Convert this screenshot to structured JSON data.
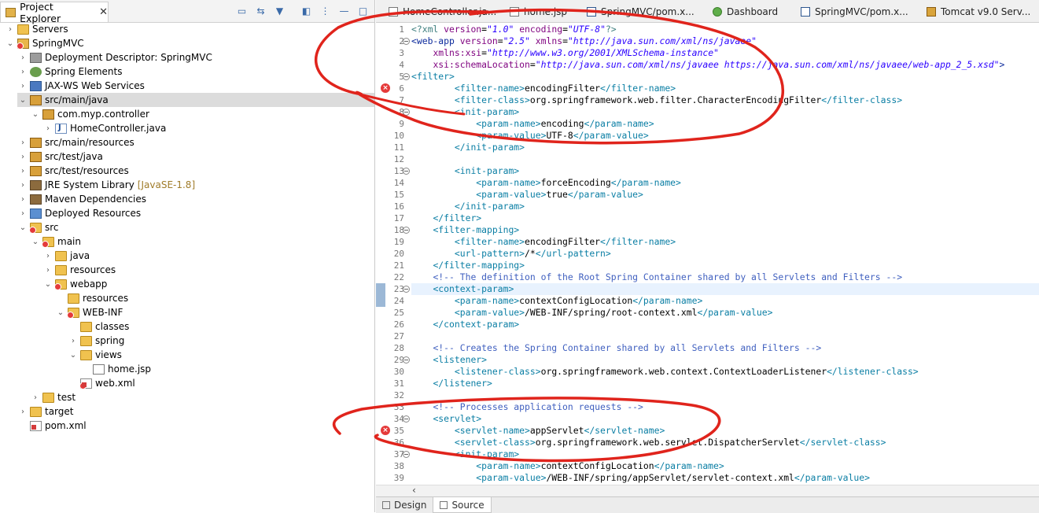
{
  "project_explorer": {
    "title": "Project Explorer",
    "close": "✕",
    "toolbar": [
      "collapse-all-icon",
      "link-editor-icon",
      "filter-icon",
      "focus-icon",
      "view-menu-icon",
      "minimize-icon",
      "maximize-icon"
    ],
    "tree": [
      {
        "label": "Servers",
        "depth": 0,
        "icon": "folder",
        "tw": "›"
      },
      {
        "label": "SpringMVC",
        "depth": 0,
        "icon": "proj",
        "tw": "⌄",
        "err": true
      },
      {
        "label": "Deployment Descriptor: SpringMVC",
        "depth": 1,
        "icon": "dd",
        "tw": "›"
      },
      {
        "label": "Spring Elements",
        "depth": 1,
        "icon": "gear",
        "tw": "›"
      },
      {
        "label": "JAX-WS Web Services",
        "depth": 1,
        "icon": "ws",
        "tw": "›"
      },
      {
        "label": "src/main/java",
        "depth": 1,
        "icon": "pkg",
        "tw": "⌄",
        "selected": true
      },
      {
        "label": "com.myp.controller",
        "depth": 2,
        "icon": "pkg",
        "tw": "⌄"
      },
      {
        "label": "HomeController.java",
        "depth": 3,
        "icon": "java",
        "tw": "›"
      },
      {
        "label": "src/main/resources",
        "depth": 1,
        "icon": "pkg",
        "tw": "›"
      },
      {
        "label": "src/test/java",
        "depth": 1,
        "icon": "pkg",
        "tw": "›"
      },
      {
        "label": "src/test/resources",
        "depth": 1,
        "icon": "pkg",
        "tw": "›"
      },
      {
        "label": "JRE System Library",
        "depth": 1,
        "icon": "lib",
        "tw": "›",
        "extra": "[JavaSE-1.8]"
      },
      {
        "label": "Maven Dependencies",
        "depth": 1,
        "icon": "lib",
        "tw": "›"
      },
      {
        "label": "Deployed Resources",
        "depth": 1,
        "icon": "deploy",
        "tw": "›"
      },
      {
        "label": "src",
        "depth": 1,
        "icon": "folder",
        "tw": "⌄",
        "err": true
      },
      {
        "label": "main",
        "depth": 2,
        "icon": "folder",
        "tw": "⌄",
        "err": true
      },
      {
        "label": "java",
        "depth": 3,
        "icon": "folder",
        "tw": "›"
      },
      {
        "label": "resources",
        "depth": 3,
        "icon": "folder",
        "tw": "›"
      },
      {
        "label": "webapp",
        "depth": 3,
        "icon": "folder",
        "tw": "⌄",
        "err": true
      },
      {
        "label": "resources",
        "depth": 4,
        "icon": "folder",
        "tw": ""
      },
      {
        "label": "WEB-INF",
        "depth": 4,
        "icon": "folder",
        "tw": "⌄",
        "err": true
      },
      {
        "label": "classes",
        "depth": 5,
        "icon": "folder",
        "tw": ""
      },
      {
        "label": "spring",
        "depth": 5,
        "icon": "folder",
        "tw": "›"
      },
      {
        "label": "views",
        "depth": 5,
        "icon": "folder",
        "tw": "⌄"
      },
      {
        "label": "home.jsp",
        "depth": 6,
        "icon": "jsp",
        "tw": ""
      },
      {
        "label": "web.xml",
        "depth": 5,
        "icon": "xml",
        "tw": "",
        "err": true
      },
      {
        "label": "test",
        "depth": 2,
        "icon": "folder",
        "tw": "›"
      },
      {
        "label": "target",
        "depth": 1,
        "icon": "folder",
        "tw": "›"
      },
      {
        "label": "pom.xml",
        "depth": 1,
        "icon": "xml",
        "tw": ""
      }
    ]
  },
  "editor_tabs": [
    {
      "label": "HomeController.ja...",
      "icon": "java"
    },
    {
      "label": "home.jsp",
      "icon": "jsp"
    },
    {
      "label": "SpringMVC/pom.x...",
      "icon": "m"
    },
    {
      "label": "Dashboard",
      "icon": "green"
    },
    {
      "label": "SpringMVC/pom.x...",
      "icon": "m"
    },
    {
      "label": "Tomcat v9.0 Serv...",
      "icon": "cat"
    }
  ],
  "code_lines": [
    {
      "n": "1",
      "html": "<span class='k'>&lt;?xml</span> <span class='at'>version</span>=<span class='av'>\"1.0\"</span> <span class='at'>encoding</span>=<span class='av'>\"UTF-8\"</span><span class='k'>?&gt;</span>"
    },
    {
      "n": "2",
      "fold": true,
      "html": "<span class='tg'>&lt;web-app</span> <span class='at'>version</span>=<span class='av'>\"2.5\"</span> <span class='at'>xmlns</span>=<span class='av'>\"http://java.sun.com/xml/ns/javaee\"</span>"
    },
    {
      "n": "3",
      "html": "    <span class='at'>xmlns:xsi</span>=<span class='av'>\"http://www.w3.org/2001/XMLSchema-instance\"</span>"
    },
    {
      "n": "4",
      "html": "    <span class='at'>xsi:schemaLocation</span>=<span class='av'>\"http://java.sun.com/xml/ns/javaee https://java.sun.com/xml/ns/javaee/web-app_2_5.xsd\"</span><span class='tg'>&gt;</span>"
    },
    {
      "n": "5",
      "fold": true,
      "html": "<span class='tgb'>&lt;filter&gt;</span>"
    },
    {
      "n": "6",
      "err": true,
      "html": "        <span class='tgb'>&lt;filter-name&gt;</span>encodingFilter<span class='tgb'>&lt;/filter-name&gt;</span>"
    },
    {
      "n": "7",
      "html": "        <span class='tgb'>&lt;filter-class&gt;</span>org.springframework.web.filter.CharacterEncodingFilter<span class='tgb'>&lt;/filter-class&gt;</span>"
    },
    {
      "n": "8",
      "fold": true,
      "html": "        <span class='tgb'>&lt;init-param&gt;</span>"
    },
    {
      "n": "9",
      "html": "            <span class='tgb'>&lt;param-name&gt;</span>encoding<span class='tgb'>&lt;/param-name&gt;</span>"
    },
    {
      "n": "10",
      "html": "            <span class='tgb'>&lt;param-value&gt;</span>UTF-8<span class='tgb'>&lt;/param-value&gt;</span>"
    },
    {
      "n": "11",
      "html": "        <span class='tgb'>&lt;/init-param&gt;</span>"
    },
    {
      "n": "12",
      "html": ""
    },
    {
      "n": "13",
      "fold": true,
      "html": "        <span class='tgb'>&lt;init-param&gt;</span>"
    },
    {
      "n": "14",
      "html": "            <span class='tgb'>&lt;param-name&gt;</span>forceEncoding<span class='tgb'>&lt;/param-name&gt;</span>"
    },
    {
      "n": "15",
      "html": "            <span class='tgb'>&lt;param-value&gt;</span>true<span class='tgb'>&lt;/param-value&gt;</span>"
    },
    {
      "n": "16",
      "html": "        <span class='tgb'>&lt;/init-param&gt;</span>"
    },
    {
      "n": "17",
      "html": "    <span class='tgb'>&lt;/filter&gt;</span>"
    },
    {
      "n": "18",
      "fold": true,
      "html": "    <span class='tgb'>&lt;filter-mapping&gt;</span>"
    },
    {
      "n": "19",
      "html": "        <span class='tgb'>&lt;filter-name&gt;</span>encodingFilter<span class='tgb'>&lt;/filter-name&gt;</span>"
    },
    {
      "n": "20",
      "html": "        <span class='tgb'>&lt;url-pattern&gt;</span>/*<span class='tgb'>&lt;/url-pattern&gt;</span>"
    },
    {
      "n": "21",
      "html": "    <span class='tgb'>&lt;/filter-mapping&gt;</span>"
    },
    {
      "n": "22",
      "html": "    <span class='cm'>&lt;!-- The definition of the Root Spring Container shared by all Servlets and Filters --&gt;</span>"
    },
    {
      "n": "23",
      "fold": true,
      "cur": true,
      "mark": true,
      "html": "    <span class='tgb'>&lt;context-param&gt;</span>"
    },
    {
      "n": "24",
      "mark": true,
      "html": "        <span class='tgb'>&lt;param-name&gt;</span>contextConfigLocation<span class='tgb'>&lt;/param-name&gt;</span>"
    },
    {
      "n": "25",
      "html": "        <span class='tgb'>&lt;param-value&gt;</span>/WEB-INF/spring/root-context.xml<span class='tgb'>&lt;/param-value&gt;</span>"
    },
    {
      "n": "26",
      "html": "    <span class='tgb'>&lt;/context-param&gt;</span>"
    },
    {
      "n": "27",
      "html": ""
    },
    {
      "n": "28",
      "html": "    <span class='cm'>&lt;!-- Creates the Spring Container shared by all Servlets and Filters --&gt;</span>"
    },
    {
      "n": "29",
      "fold": true,
      "html": "    <span class='tgb'>&lt;listener&gt;</span>"
    },
    {
      "n": "30",
      "html": "        <span class='tgb'>&lt;listener-class&gt;</span>org.springframework.web.context.ContextLoaderListener<span class='tgb'>&lt;/listener-class&gt;</span>"
    },
    {
      "n": "31",
      "html": "    <span class='tgb'>&lt;/listener&gt;</span>"
    },
    {
      "n": "32",
      "html": ""
    },
    {
      "n": "33",
      "html": "    <span class='cm'>&lt;!-- Processes application requests --&gt;</span>"
    },
    {
      "n": "34",
      "fold": true,
      "html": "    <span class='tgb'>&lt;servlet&gt;</span>"
    },
    {
      "n": "35",
      "err": true,
      "html": "        <span class='tgb'>&lt;servlet-name&gt;</span>appServlet<span class='tgb'>&lt;/servlet-name&gt;</span>"
    },
    {
      "n": "36",
      "html": "        <span class='tgb'>&lt;servlet-class&gt;</span>org.springframework.web.servlet.DispatcherServlet<span class='tgb'>&lt;/servlet-class&gt;</span>"
    },
    {
      "n": "37",
      "fold": true,
      "html": "        <span class='tgb'>&lt;init-param&gt;</span>"
    },
    {
      "n": "38",
      "html": "            <span class='tgb'>&lt;param-name&gt;</span>contextConfigLocation<span class='tgb'>&lt;/param-name&gt;</span>"
    },
    {
      "n": "39",
      "html": "            <span class='tgb'>&lt;param-value&gt;</span>/WEB-INF/spring/appServlet/servlet-context.xml<span class='tgb'>&lt;/param-value&gt;</span>"
    }
  ],
  "hscroll_arrow": "‹",
  "bottom_tabs": [
    {
      "label": "Design",
      "active": false
    },
    {
      "label": "Source",
      "active": true
    }
  ],
  "colors": {
    "annotation": "#e0241c",
    "error": "#e53a3a"
  }
}
